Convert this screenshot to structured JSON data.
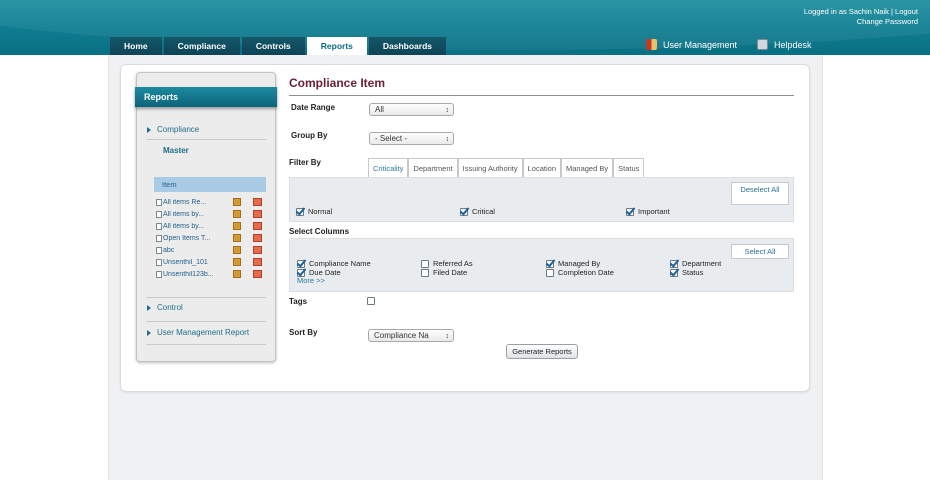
{
  "header": {
    "logged_in_prefix": "Logged in as",
    "user_name": "Sachin Naik",
    "separator": "|",
    "logout": "Logout",
    "change_password": "Change Password",
    "nav_tabs": [
      "Home",
      "Compliance",
      "Controls",
      "Reports",
      "Dashboards"
    ],
    "active_tab": "Reports",
    "user_management": "User Management",
    "helpdesk": "Helpdesk"
  },
  "sidebar": {
    "title": "Reports",
    "compliance_label": "Compliance",
    "master_label": "Master",
    "item_label": "Item",
    "reports": [
      "All items Re...",
      "All items by...",
      "All items by...",
      "Open Items T...",
      "abc",
      "Unsenthil_101",
      "Unsenthil123b..."
    ],
    "control_label": "Control",
    "user_mgmt_report_label": "User Management Report"
  },
  "form": {
    "title": "Compliance Item",
    "date_range_label": "Date Range",
    "date_range_value": "All",
    "group_by_label": "Group By",
    "group_by_value": "- Select -",
    "filter_by_label": "Filter By",
    "filter_tabs": [
      "Criticality",
      "Department",
      "Issuing Authority",
      "Location",
      "Managed By",
      "Status"
    ],
    "active_filter_tab": "Criticality",
    "deselect_all": "Deselect All",
    "criticality_options": [
      {
        "label": "Normal",
        "checked": true
      },
      {
        "label": "Critical",
        "checked": true
      },
      {
        "label": "Important",
        "checked": true
      }
    ],
    "select_columns_label": "Select Columns",
    "select_all": "Select All",
    "columns": [
      {
        "label": "Compliance Name",
        "checked": true
      },
      {
        "label": "Due Date",
        "checked": true
      },
      {
        "label": "Referred As",
        "checked": false
      },
      {
        "label": "Filed Date",
        "checked": false
      },
      {
        "label": "Managed By",
        "checked": true
      },
      {
        "label": "Completion Date",
        "checked": false
      },
      {
        "label": "Department",
        "checked": true
      },
      {
        "label": "Status",
        "checked": true
      }
    ],
    "more_link": "More >>",
    "tags_label": "Tags",
    "sort_by_label": "Sort By",
    "sort_by_value": "Compliance Na",
    "generate_button": "Generate Reports"
  },
  "colors": {
    "header_teal": "#0f7f93",
    "title_maroon": "#6a2135",
    "link_blue": "#2c7aa4"
  }
}
